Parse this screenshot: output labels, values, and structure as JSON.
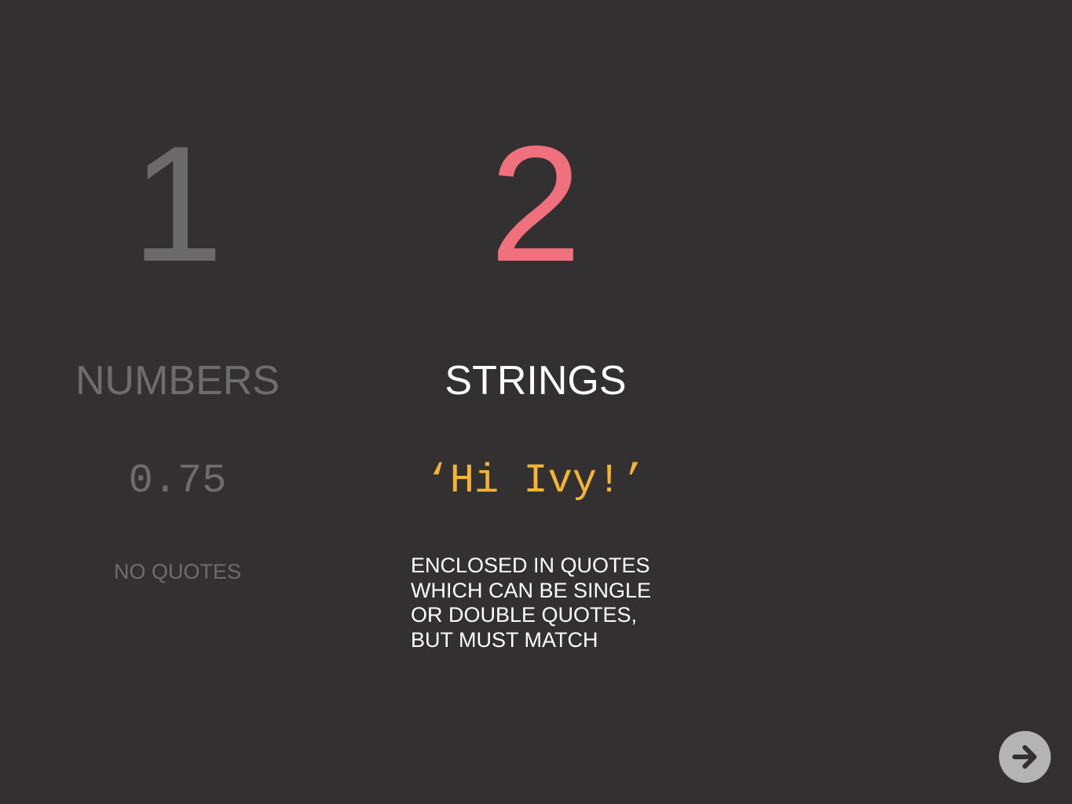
{
  "columns": [
    {
      "number": "1",
      "heading": "NUMBERS",
      "example": "0.75",
      "description": "NO QUOTES"
    },
    {
      "number": "2",
      "heading": "STRINGS",
      "example": "‘Hi Ivy!’",
      "description_lines": [
        "ENCLOSED IN QUOTES",
        "WHICH CAN BE SINGLE",
        "OR DOUBLE QUOTES,",
        "BUT MUST MATCH"
      ]
    }
  ],
  "navigation": {
    "next_icon": "arrow-right-icon"
  },
  "colors": {
    "background": "#323031",
    "dimmed_text": "#6e6d6d",
    "accent_number": "#f1707d",
    "string_example": "#f5b233",
    "active_text": "#ffffff",
    "nav_button": "#b5b4b4"
  }
}
